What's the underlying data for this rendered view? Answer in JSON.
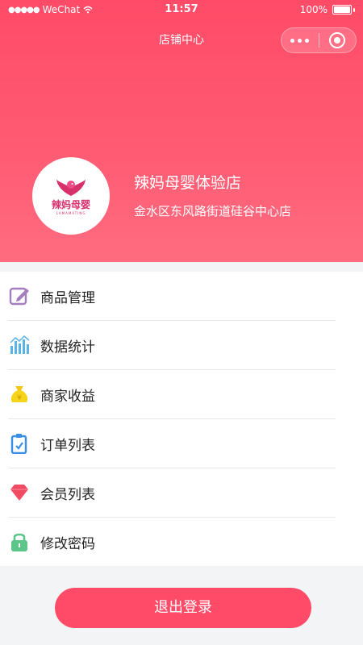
{
  "status_bar": {
    "carrier": "WeChat",
    "time": "11:57",
    "battery": "100%"
  },
  "nav": {
    "title": "店铺中心"
  },
  "shop": {
    "logo_text": "辣妈母婴",
    "logo_subtext": "LAMAMATING",
    "name": "辣妈母婴体验店",
    "address": "金水区东风路街道硅谷中心店"
  },
  "menu": {
    "items": [
      {
        "label": "商品管理",
        "icon": "edit-icon"
      },
      {
        "label": "数据统计",
        "icon": "chart-icon"
      },
      {
        "label": "商家收益",
        "icon": "money-bag-icon"
      },
      {
        "label": "订单列表",
        "icon": "clipboard-icon"
      },
      {
        "label": "会员列表",
        "icon": "diamond-icon"
      },
      {
        "label": "修改密码",
        "icon": "lock-icon"
      }
    ]
  },
  "logout_label": "退出登录",
  "colors": {
    "brand": "#ff4b67",
    "background": "#f3f4f6"
  }
}
